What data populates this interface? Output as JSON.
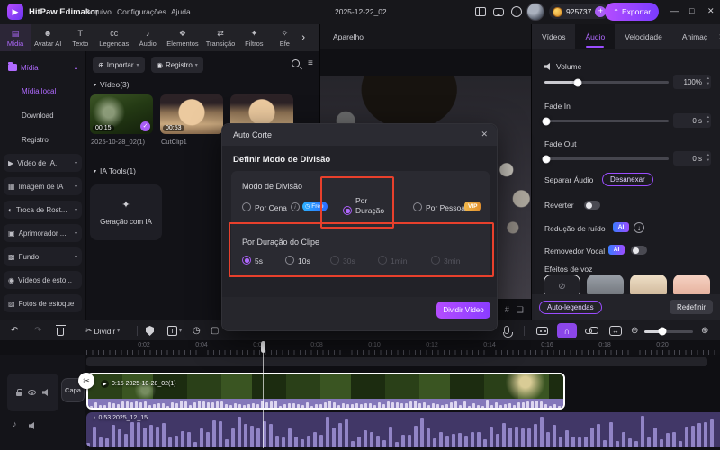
{
  "colors": {
    "accent": "#9b4dff",
    "accent_light": "#b06aff",
    "annotation_red": "#e8402c",
    "free_badge": "#2b7bff",
    "vip_badge": "#e9a43c",
    "waveform": "#9184c6",
    "clip_wave": "#ddd6f0"
  },
  "icons": {
    "media": "▤",
    "avatar": "☻",
    "text": "T",
    "captions": "cc",
    "audio": "♪",
    "elements": "❖",
    "transition": "⇄",
    "filters": "✦",
    "effects": "✧",
    "chevron": "›",
    "caret_down": "▾",
    "caret_up": "▴",
    "plus_circle": "⊕",
    "record_dot": "◉",
    "undo": "↶",
    "redo": "↷",
    "scissors": "✂",
    "gauge": "◷",
    "crop": "▢",
    "zoom_in": "⊕",
    "zoom_out": "⊖",
    "fit": "↔",
    "magnet": "∩",
    "down_arrow": "↓",
    "export_arrow": "↥",
    "play": "▶",
    "note": "♪",
    "check": "✓",
    "close": "✕",
    "info": "i",
    "minimize": "—",
    "maximize": "□",
    "plus": "+",
    "hash": "#",
    "fullscreen": "❏",
    "none": "⊘",
    "video_ai": "▶",
    "image_ai": "▦",
    "face_swap": "◐",
    "enhancer": "▣",
    "background": "▩",
    "stock_video": "◉",
    "stock_photo": "▨",
    "wand": "✦",
    "speaker_mute": "◁"
  },
  "titlebar": {
    "app_title": "HitPaw Edimakor",
    "menus": [
      "Arquivo",
      "Configurações",
      "Ajuda"
    ],
    "project_name": "2025-12-22_02",
    "credits": "925737",
    "export_label": "Exportar"
  },
  "ribbon": {
    "active": "Mídia",
    "tabs": [
      {
        "label": "Mídia"
      },
      {
        "label": "Avatar AI"
      },
      {
        "label": "Texto"
      },
      {
        "label": "Legendas"
      },
      {
        "label": "Áudio"
      },
      {
        "label": "Elementos"
      },
      {
        "label": "Transição"
      },
      {
        "label": "Filtros"
      },
      {
        "label": "Efe"
      }
    ]
  },
  "sidebar": {
    "items": [
      {
        "label": "Mídia"
      },
      {
        "label": "Mídia local"
      },
      {
        "label": "Download"
      },
      {
        "label": "Registro"
      },
      {
        "label": "Vídeo de IA."
      },
      {
        "label": "Imagem de IA"
      },
      {
        "label": "Troca de Rost..."
      },
      {
        "label": "Aprimorador ..."
      },
      {
        "label": "Fundo"
      },
      {
        "label": "Vídeos de esto..."
      },
      {
        "label": "Fotos de estoque"
      }
    ]
  },
  "media_panel": {
    "import_label": "Importar",
    "record_label": "Registro",
    "video_section": "Vídeo(3)",
    "ia_section": "IA Tools(1)",
    "ia_card": "Geração com IA",
    "clips": [
      {
        "duration": "00:15",
        "name": "2025-10-28_02(1)"
      },
      {
        "duration": "00:53",
        "name": "CutClip1"
      }
    ]
  },
  "preview": {
    "header": "Aparelho"
  },
  "right_panel": {
    "active_tab": "Áudio",
    "tabs": [
      {
        "label": "Vídeos"
      },
      {
        "label": "Áudio"
      },
      {
        "label": "Velocidade"
      },
      {
        "label": "Animaç"
      }
    ],
    "volume": {
      "label": "Volume",
      "value": "100%"
    },
    "fade_in": {
      "label": "Fade In",
      "value": "0 s"
    },
    "fade_out": {
      "label": "Fade Out",
      "value": "0 s"
    },
    "separate_audio": {
      "label": "Separar Áudio",
      "button": "Desanexar"
    },
    "reverse_label": "Reverter",
    "noise_label": "Redução de ruído",
    "vocal_label": "Removedor Vocal",
    "ai_badge": "AI",
    "voice_effects_label": "Efeitos de voz",
    "auto_captions": "Auto-legendas",
    "reset": "Redefinir"
  },
  "dialog": {
    "title": "Auto Corte",
    "heading": "Definir Modo de Divisão",
    "mode_label": "Modo de Divisão",
    "modes": [
      {
        "label": "Por Cena",
        "badge": "Free",
        "selected": false
      },
      {
        "label": "Por Duração",
        "selected": true
      },
      {
        "label": "Por Pessoa",
        "badge": "VIP",
        "selected": false
      }
    ],
    "duration_label": "Por Duração do Clipe",
    "durations": [
      {
        "label": "5s",
        "selected": true
      },
      {
        "label": "10s",
        "selected": false
      },
      {
        "label": "30s",
        "disabled": true
      },
      {
        "label": "1min",
        "disabled": true
      },
      {
        "label": "3min",
        "disabled": true
      }
    ],
    "confirm": "Dividir Vídeo"
  },
  "timeline": {
    "split_label": "Dividir",
    "capa_label": "Capa",
    "ruler": [
      "0:02",
      "0:04",
      "0:06",
      "0:08",
      "0:10",
      "0:12",
      "0:14",
      "0:16",
      "0:18",
      "0:20"
    ],
    "video_clip_label": "0:15 2025-10-28_02(1)",
    "audio_clip_label": "0:53 2025_12_15"
  }
}
